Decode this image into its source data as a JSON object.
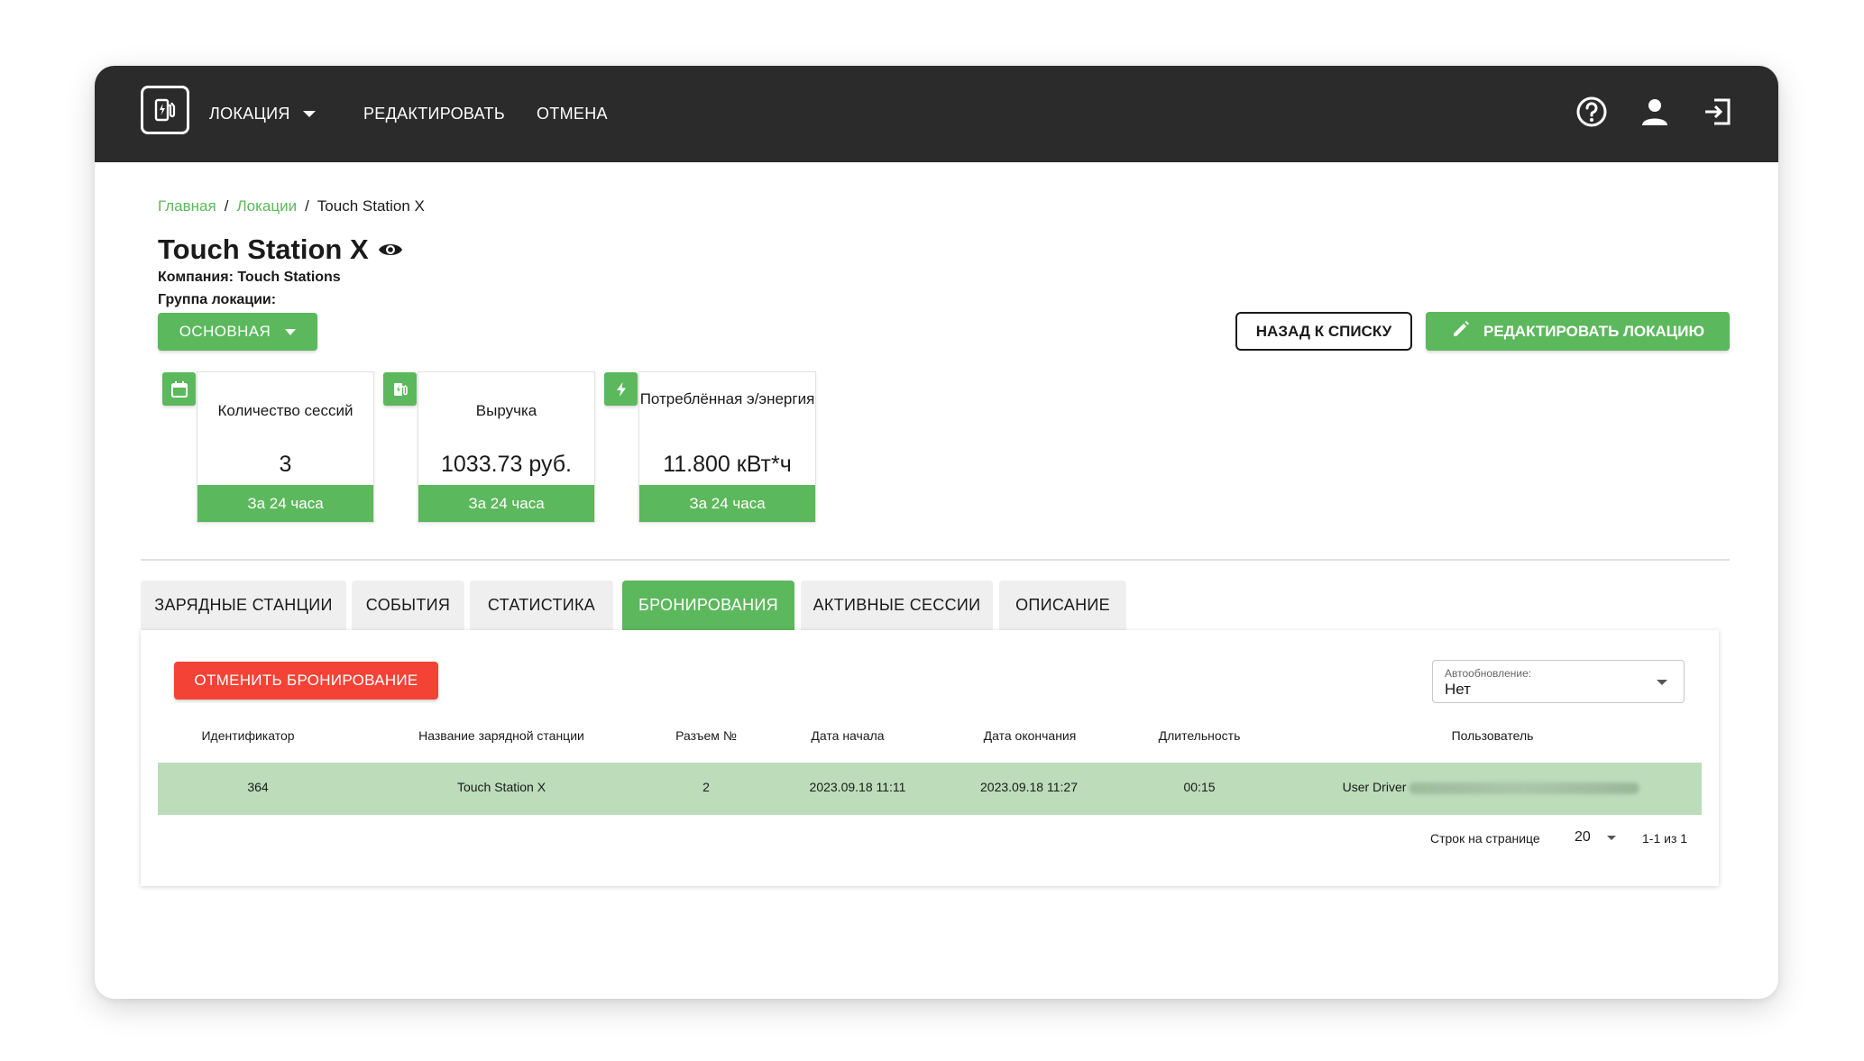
{
  "header": {
    "nav": [
      {
        "label": "ЛОКАЦИЯ"
      },
      {
        "label": "РЕДАКТИРОВАТЬ"
      },
      {
        "label": "ОТМЕНА"
      }
    ],
    "icons": [
      "charging-station-logo-icon",
      "help-icon",
      "user-icon",
      "logout-icon"
    ]
  },
  "breadcrumb": {
    "home": "Главная",
    "locations": "Локации",
    "current": "Touch Station X"
  },
  "location": {
    "title": "Touch Station X",
    "company": "Компания: Touch Stations",
    "group_label": "Группа локации:",
    "group_value": "ОСНОВНАЯ"
  },
  "actions": {
    "back": "НАЗАД К СПИСКУ",
    "edit": "РЕДАКТИРОВАТЬ ЛОКАЦИЮ"
  },
  "stats": [
    {
      "title": "Количество сессий",
      "value": "3",
      "period": "За 24 часа",
      "icon": "calendar-icon"
    },
    {
      "title": "Выручка",
      "value": "1033.73 руб.",
      "period": "За 24 часа",
      "icon": "fuel-station-icon"
    },
    {
      "title": "Потреблённая э/энергия",
      "value": "11.800 кВт*ч",
      "period": "За 24 часа",
      "icon": "lightning-icon"
    }
  ],
  "tabs": [
    {
      "label": "ЗАРЯДНЫЕ СТАНЦИИ",
      "active": false
    },
    {
      "label": "СОБЫТИЯ",
      "active": false
    },
    {
      "label": "СТАТИСТИКА",
      "active": false
    },
    {
      "label": "БРОНИРОВАНИЯ",
      "active": true
    },
    {
      "label": "АКТИВНЫЕ СЕССИИ",
      "active": false
    },
    {
      "label": "ОПИСАНИЕ",
      "active": false
    }
  ],
  "bookings": {
    "cancel_button": "ОТМЕНИТЬ БРОНИРОВАНИЕ",
    "autoupdate_label": "Автообновление:",
    "autoupdate_value": "Нет",
    "columns": [
      "Идентификатор",
      "Название зарядной станции",
      "Разъем №",
      "Дата начала",
      "Дата окончания",
      "Длительность",
      "Пользователь"
    ],
    "rows": [
      {
        "id": "364",
        "station": "Touch Station X",
        "connector": "2",
        "start": "2023.09.18 11:11",
        "end": "2023.09.18 11:27",
        "duration": "00:15",
        "user": "User Driver"
      }
    ],
    "rows_per_page_label": "Строк на странице",
    "rows_per_page": "20",
    "range": "1-1 из 1"
  },
  "colors": {
    "accent": "#5cb85c",
    "danger": "#f44336",
    "header_bg": "#2b2b2b",
    "row_selected": "#bcdcba"
  }
}
